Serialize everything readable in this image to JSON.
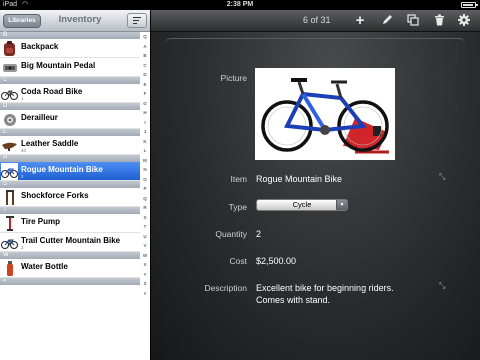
{
  "status_bar": {
    "carrier": "iPad",
    "time": "2:38 PM"
  },
  "left_panel": {
    "libraries_label": "Libraries",
    "title": "Inventory",
    "items": [
      {
        "section": "B",
        "title": "Backpack",
        "qty": ""
      },
      {
        "section": "",
        "title": "Big Mountain Pedal",
        "qty": ""
      },
      {
        "section": "C",
        "title": "Coda Road Bike",
        "qty": "1"
      },
      {
        "section": "D",
        "title": "Derailleur",
        "qty": ""
      },
      {
        "section": "L",
        "title": "Leather Saddle",
        "qty": "40"
      },
      {
        "section": "R",
        "title": "Rogue Mountain Bike",
        "qty": "2",
        "selected": true
      },
      {
        "section": "S",
        "title": "Shockforce Forks",
        "qty": ""
      },
      {
        "section": "T",
        "title": "Tire Pump",
        "qty": ""
      },
      {
        "section": "",
        "title": "Trail Cutter Mountain Bike",
        "qty": "2"
      },
      {
        "section": "W",
        "title": "Water Bottle",
        "qty": ""
      },
      {
        "section": "#",
        "title": "",
        "qty": ""
      }
    ],
    "index_letters": [
      "Q",
      "A",
      "B",
      "C",
      "D",
      "E",
      "F",
      "G",
      "H",
      "I",
      "J",
      "K",
      "L",
      "M",
      "N",
      "O",
      "P",
      "Q",
      "R",
      "S",
      "T",
      "U",
      "V",
      "W",
      "X",
      "Y",
      "Z",
      "#"
    ]
  },
  "right_panel": {
    "position": "6 of 31",
    "toolbar_icons": [
      "add-icon",
      "edit-pencil-icon",
      "duplicate-icon",
      "trash-icon",
      "gear-icon"
    ],
    "fields": {
      "picture_label": "Picture",
      "item_label": "Item",
      "item_value": "Rogue Mountain Bike",
      "type_label": "Type",
      "type_value": "Cycle",
      "quantity_label": "Quantity",
      "quantity_value": "2",
      "cost_label": "Cost",
      "cost_value": "$2,500.00",
      "description_label": "Description",
      "description_line1": "Excellent bike for beginning riders.",
      "description_line2": "Comes with stand."
    }
  }
}
